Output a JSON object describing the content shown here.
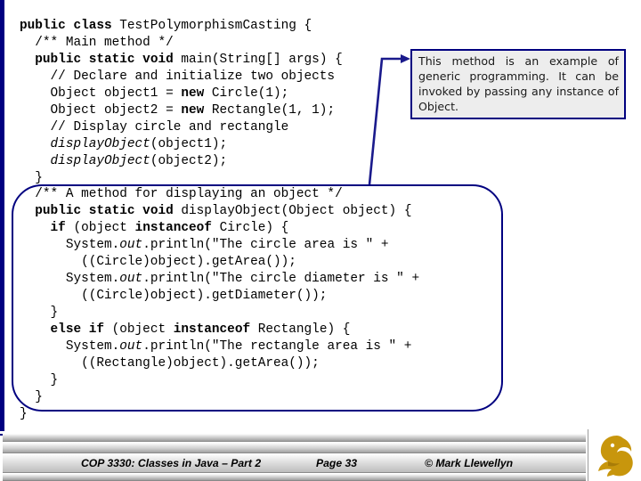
{
  "slide": {
    "accent_color": "#000080",
    "callout_fill": "#ededed",
    "logo_color": "#c8960c"
  },
  "code_top": {
    "lines": [
      [
        {
          "t": "public class ",
          "style": "bold"
        },
        {
          "t": "TestPolymorphismCasting {",
          "style": "plain"
        }
      ],
      [
        {
          "t": "  /** Main method */",
          "style": "plain"
        }
      ],
      [
        {
          "t": "  ",
          "style": "plain"
        },
        {
          "t": "public static void ",
          "style": "bold"
        },
        {
          "t": "main(String[] args) {",
          "style": "plain"
        }
      ],
      [
        {
          "t": "    // Declare and initialize two objects",
          "style": "plain"
        }
      ],
      [
        {
          "t": "    Object object1 = ",
          "style": "plain"
        },
        {
          "t": "new ",
          "style": "bold"
        },
        {
          "t": "Circle(1);",
          "style": "plain"
        }
      ],
      [
        {
          "t": "    Object object2 = ",
          "style": "plain"
        },
        {
          "t": "new ",
          "style": "bold"
        },
        {
          "t": "Rectangle(1, 1);",
          "style": "plain"
        }
      ],
      [
        {
          "t": "    // Display circle and rectangle",
          "style": "plain"
        }
      ],
      [
        {
          "t": "    ",
          "style": "plain"
        },
        {
          "t": "displayObject",
          "style": "italic"
        },
        {
          "t": "(object1);",
          "style": "plain"
        }
      ],
      [
        {
          "t": "    ",
          "style": "plain"
        },
        {
          "t": "displayObject",
          "style": "italic"
        },
        {
          "t": "(object2);",
          "style": "plain"
        }
      ],
      [
        {
          "t": "  }",
          "style": "plain"
        }
      ]
    ]
  },
  "code_bottom": {
    "lines": [
      [
        {
          "t": "  /** A method for displaying an object */",
          "style": "plain"
        }
      ],
      [
        {
          "t": "  ",
          "style": "plain"
        },
        {
          "t": "public static void ",
          "style": "bold"
        },
        {
          "t": "displayObject(Object object) {",
          "style": "plain"
        }
      ],
      [
        {
          "t": "    ",
          "style": "plain"
        },
        {
          "t": "if ",
          "style": "bold"
        },
        {
          "t": "(object ",
          "style": "plain"
        },
        {
          "t": "instanceof ",
          "style": "bold"
        },
        {
          "t": "Circle) {",
          "style": "plain"
        }
      ],
      [
        {
          "t": "      System.",
          "style": "plain"
        },
        {
          "t": "out",
          "style": "italic"
        },
        {
          "t": ".println(\"The circle area is \" +",
          "style": "plain"
        }
      ],
      [
        {
          "t": "        ((Circle)object).getArea());",
          "style": "plain"
        }
      ],
      [
        {
          "t": "      System.",
          "style": "plain"
        },
        {
          "t": "out",
          "style": "italic"
        },
        {
          "t": ".println(\"The circle diameter is \" +",
          "style": "plain"
        }
      ],
      [
        {
          "t": "        ((Circle)object).getDiameter());",
          "style": "plain"
        }
      ],
      [
        {
          "t": "    }",
          "style": "plain"
        }
      ],
      [
        {
          "t": "    ",
          "style": "plain"
        },
        {
          "t": "else if ",
          "style": "bold"
        },
        {
          "t": "(object ",
          "style": "plain"
        },
        {
          "t": "instanceof ",
          "style": "bold"
        },
        {
          "t": "Rectangle) {",
          "style": "plain"
        }
      ],
      [
        {
          "t": "      System.",
          "style": "plain"
        },
        {
          "t": "out",
          "style": "italic"
        },
        {
          "t": ".println(\"The rectangle area is \" +",
          "style": "plain"
        }
      ],
      [
        {
          "t": "        ((Rectangle)object).getArea());",
          "style": "plain"
        }
      ],
      [
        {
          "t": "    }",
          "style": "plain"
        }
      ],
      [
        {
          "t": "  }",
          "style": "plain"
        }
      ],
      [
        {
          "t": "}",
          "style": "plain"
        }
      ]
    ]
  },
  "callout": {
    "text": "This method is an example of generic programming.  It can be invoked by passing any instance of Object."
  },
  "footer": {
    "course": "COP 3330:  Classes in Java – Part 2",
    "page": "Page 33",
    "author": "© Mark Llewellyn"
  }
}
